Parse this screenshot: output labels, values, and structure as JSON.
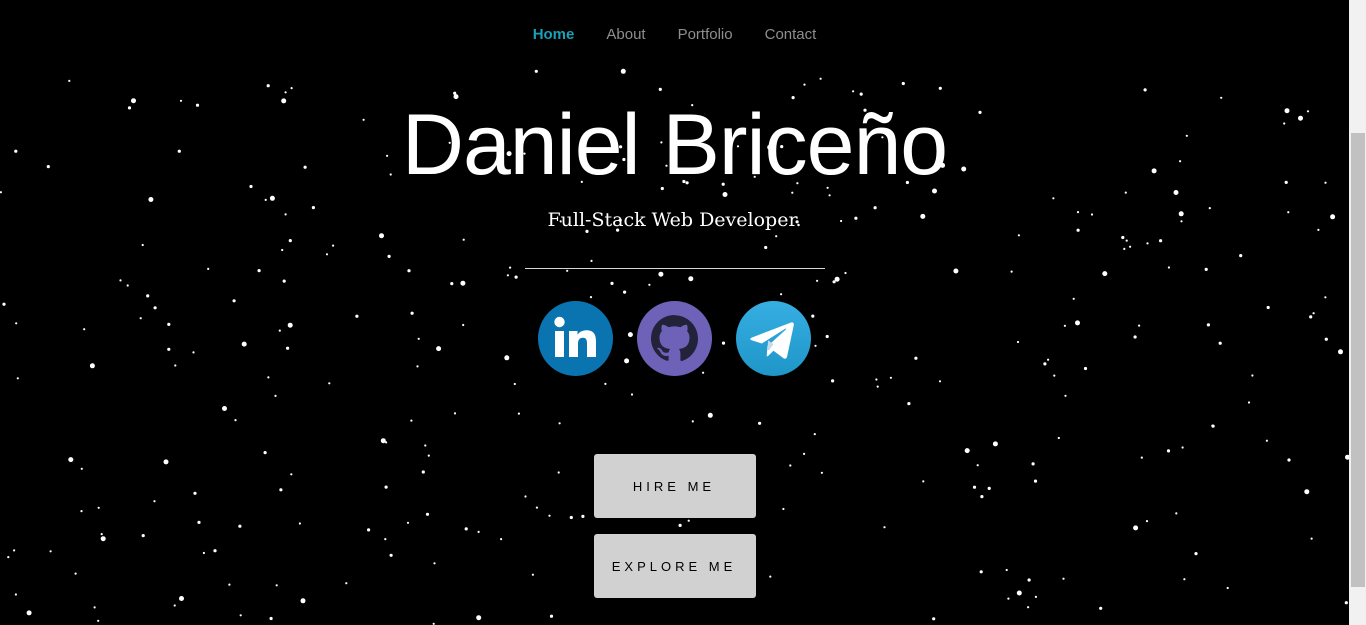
{
  "nav": {
    "items": [
      {
        "label": "Home",
        "active": true
      },
      {
        "label": "About",
        "active": false
      },
      {
        "label": "Portfolio",
        "active": false
      },
      {
        "label": "Contact",
        "active": false
      }
    ]
  },
  "hero": {
    "name": "Daniel Briceño",
    "tagline": "Full-Stack Web Developer."
  },
  "social": [
    {
      "icon": "linkedin-icon",
      "label": "in",
      "color": "#0077b5"
    },
    {
      "icon": "github-icon",
      "color": "#6e5fb6"
    },
    {
      "icon": "telegram-icon",
      "color": "#2aa3d9"
    }
  ],
  "buttons": {
    "hire": "HIRE ME",
    "explore": "EXPLORE ME"
  },
  "colors": {
    "background": "#000000",
    "accent": "#1b9fb5",
    "button_bg": "#d0d1d0"
  }
}
